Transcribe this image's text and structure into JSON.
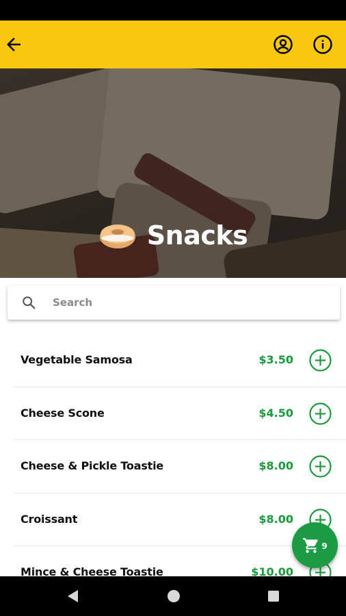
{
  "app_bar": {
    "back_icon": "arrow-back-icon",
    "account_icon": "account-circle-icon",
    "info_icon": "info-icon",
    "background_color": "#f9c70f"
  },
  "hero": {
    "emoji": "🥯",
    "title": "Snacks"
  },
  "search": {
    "placeholder": "Search",
    "value": ""
  },
  "menu_items": [
    {
      "name": "Vegetable Samosa",
      "price": "$3.50"
    },
    {
      "name": "Cheese Scone",
      "price": "$4.50"
    },
    {
      "name": "Cheese & Pickle Toastie",
      "price": "$8.00"
    },
    {
      "name": "Croissant",
      "price": "$8.00"
    },
    {
      "name": "Mince & Cheese Toastie",
      "price": "$10.00"
    }
  ],
  "cart": {
    "count": "9",
    "icon": "cart-icon",
    "color": "#1c9b45"
  },
  "colors": {
    "price": "#1a9a3c",
    "accent": "#f9c70f"
  },
  "nav_bar": {
    "back_icon": "nav-back-triangle-icon",
    "home_icon": "nav-home-circle-icon",
    "recent_icon": "nav-recent-square-icon"
  }
}
